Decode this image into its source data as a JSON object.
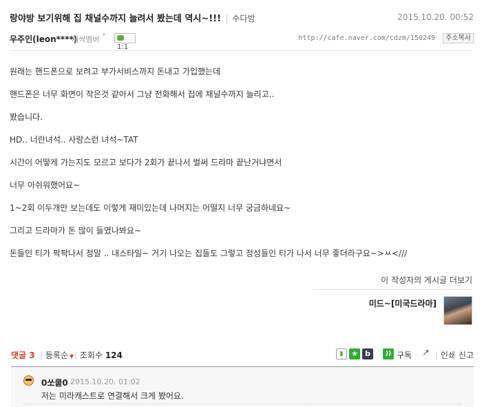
{
  "post": {
    "title": "랑야방 보기위해 집 채널수까지 늘려서 봤는데 역시~!!!",
    "board": "수다방",
    "date": "2015.10.20. 00:52",
    "author": "우주인(leon****)",
    "member_level": "새싹멤버",
    "chat_badge": "1:1",
    "url": "http://cafe.naver.com/cdzm/150249",
    "copy_url_label": "주소복사",
    "body": [
      "원래는 핸드폰으로 보려고 부가서비스까지 돈내고 가입했는데",
      "핸드폰은 너무 화면이 작은것 같아서 그냥 전화해서 집에 채널수까지 늘리고..",
      "봤습니다.",
      "HD.. 너란녀석.. 사랑스런 녀석~TAT",
      "시간이 어떻게 가는지도 모르고 보다가 2회가 끝나서 벌써 드라마 끝난거냐면서",
      "너무 아쉬워했어요~",
      "1~2회 이두개만 보는데도 이렇게 재미있는데 나머지는 어떨지 너무 궁금하네요~",
      "그리고 드라마가 돈 많이 들였나봐요~",
      "돈들인 티가 팍팍나서 정말 .. 내스타일~ 거기 나오는 집들도 그렇고 정성들인 티가 나서 너무 좋더라구요~>ㅆ<///"
    ]
  },
  "more_posts": {
    "label": "이 작성자의 게시글 더보기",
    "board_tag": "미드~[미국드라마]"
  },
  "actions": {
    "comment_label": "댓글",
    "comment_count": "3",
    "sort_label": "등록순",
    "views_label": "조회수",
    "views_count": "124",
    "subscribe_label": "구독",
    "print_label": "인쇄",
    "report_label": "신고"
  },
  "comments": [
    {
      "author": "0쏘쿨0",
      "date": "2015.10.20. 01:02",
      "text": "저는 미라캐스트로 연결해서 크게 봤어요."
    }
  ],
  "colors": {
    "accent_red": "#e03c2c",
    "naver_green": "#2dae35"
  }
}
